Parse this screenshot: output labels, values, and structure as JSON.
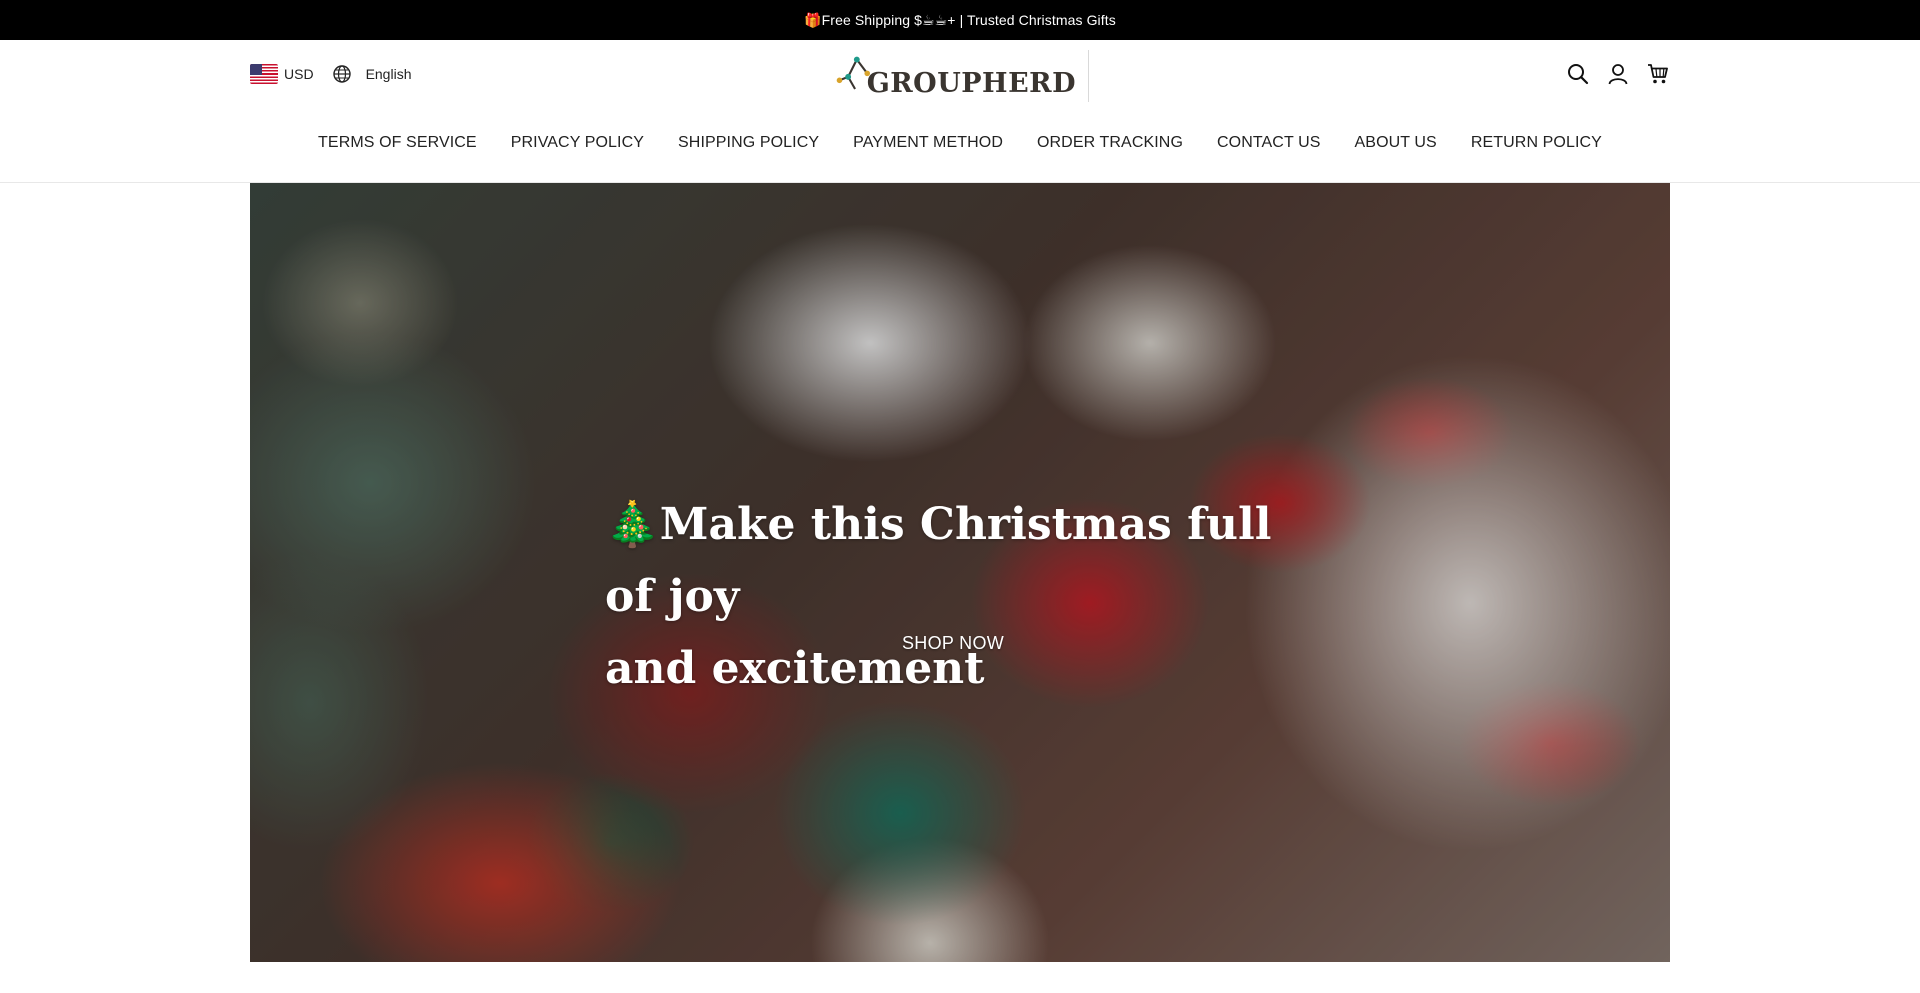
{
  "announcement": {
    "text": "🎁Free Shipping $☕☕+ | Trusted Christmas Gifts"
  },
  "header": {
    "currency": "USD",
    "language": "English",
    "logo_text": "GROUPHERD",
    "icons": [
      "search-icon",
      "account-icon",
      "cart-icon"
    ]
  },
  "nav": {
    "items": [
      "TERMS OF SERVICE",
      "PRIVACY POLICY",
      "SHIPPING POLICY",
      "PAYMENT METHOD",
      "ORDER TRACKING",
      "CONTACT US",
      "ABOUT US",
      "RETURN POLICY"
    ]
  },
  "hero": {
    "title_line1": "🎄Make this Christmas full of joy",
    "title_line2": "and excitement",
    "cta": "SHOP NOW"
  },
  "colors": {
    "announcement_bg": "#000000",
    "text_dark": "#222222",
    "logo_dark": "#3a3530",
    "logo_teal": "#1f9a8a",
    "logo_gold": "#d8a32a"
  }
}
